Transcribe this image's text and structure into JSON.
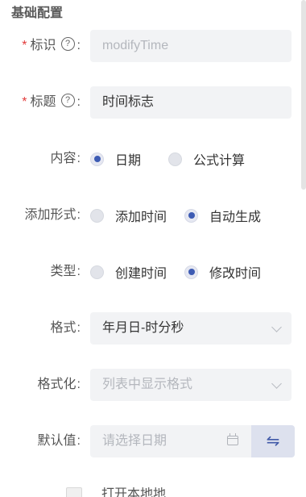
{
  "section": {
    "title": "基础配置"
  },
  "colon": ":",
  "fields": {
    "identifier": {
      "label": "标识",
      "placeholder": "modifyTime",
      "help": "?"
    },
    "title": {
      "label": "标题",
      "value": "时间标志",
      "help": "?"
    },
    "content": {
      "label": "内容",
      "options": [
        "日期",
        "公式计算"
      ],
      "selected": "日期"
    },
    "add_form": {
      "label": "添加形式",
      "options": [
        "添加时间",
        "自动生成"
      ],
      "selected": "自动生成"
    },
    "type": {
      "label": "类型",
      "options": [
        "创建时间",
        "修改时间"
      ],
      "selected": "修改时间"
    },
    "format": {
      "label": "格式",
      "value": "年月日-时分秒"
    },
    "formatting": {
      "label": "格式化",
      "placeholder": "列表中显示格式"
    },
    "default_value": {
      "label": "默认值",
      "placeholder": "请选择日期",
      "swap_symbol": "⇋"
    }
  },
  "partial_item": {
    "text": "打开本地地"
  },
  "icons": {
    "help": "question-circle-icon",
    "dropdown": "chevron-down-icon",
    "calendar": "calendar-icon",
    "swap": "swap-icon"
  },
  "colors": {
    "accent": "#3d5bb3",
    "required": "#e23b3b",
    "field_bg": "#f2f3f5"
  }
}
